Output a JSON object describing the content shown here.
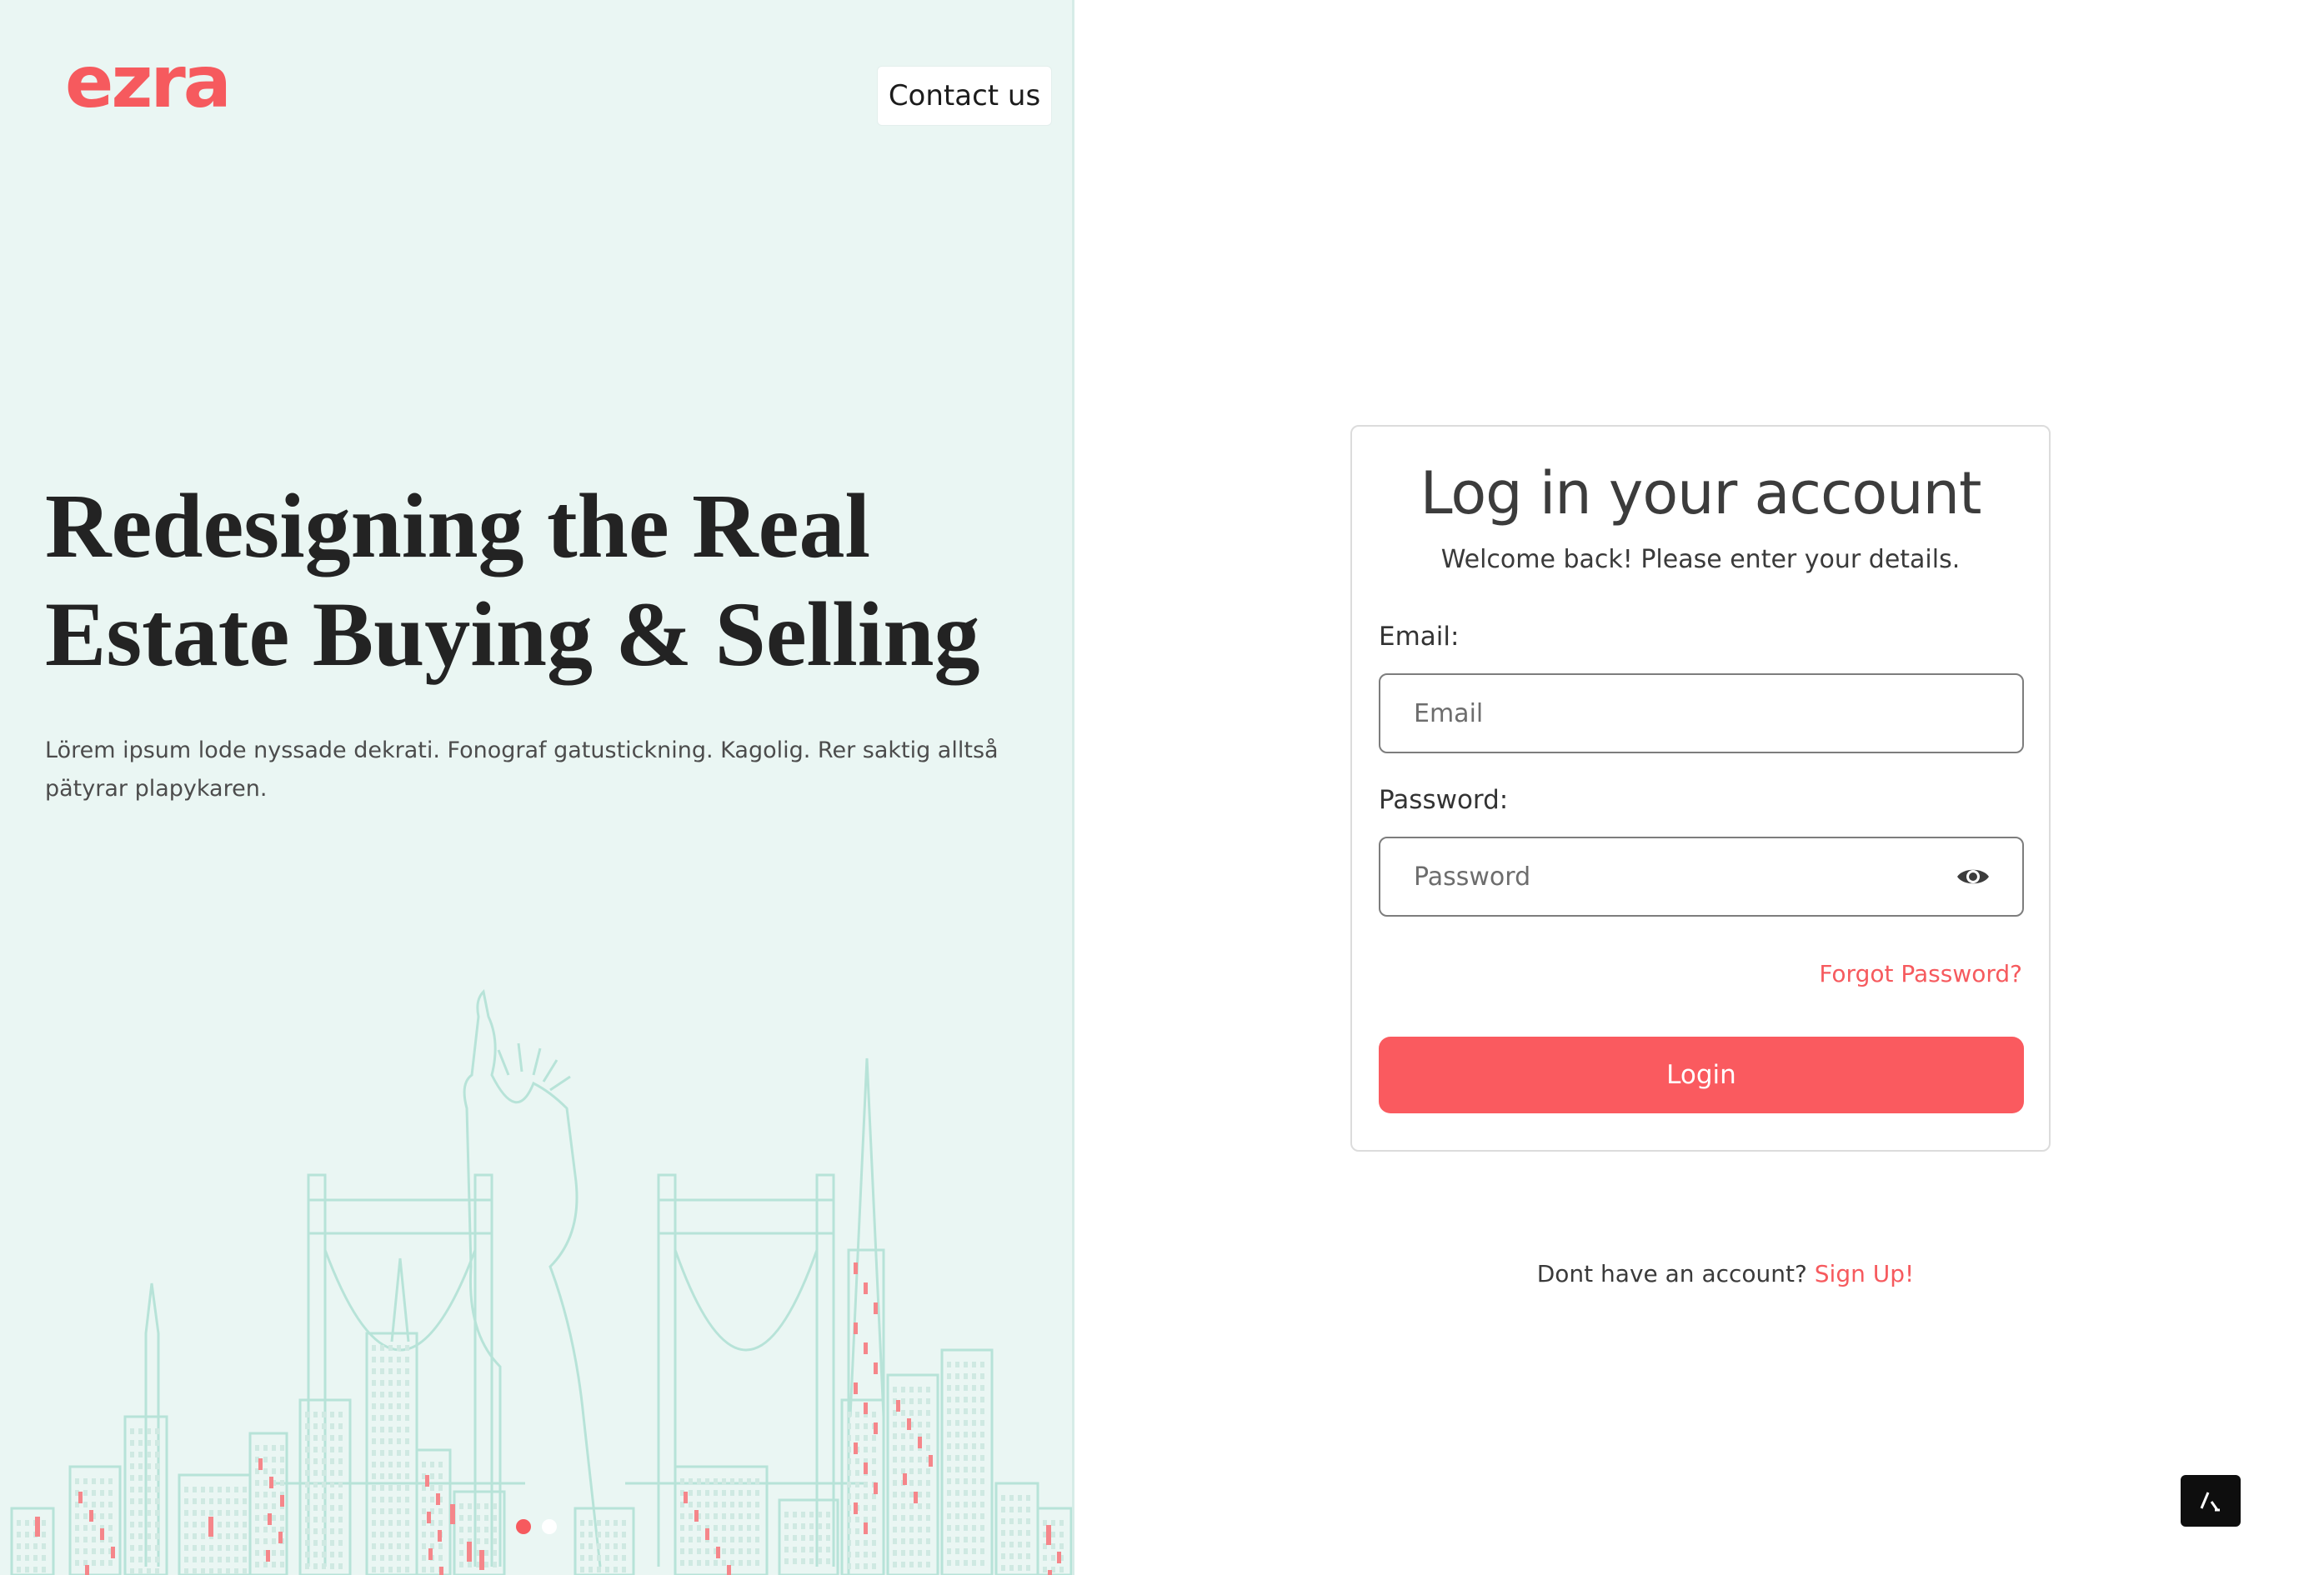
{
  "brand": {
    "logo_text": "ezra",
    "accent_color": "#f65a5e"
  },
  "hero": {
    "contact_label": "Contact us",
    "headline_line1": "Redesigning the Real",
    "headline_line2": "Estate Buying & Selling",
    "description": "Lörem ipsum lode nyssade dekrati. Fonograf gatustickning. Kagolig. Rer saktig alltså pätyrar plapykaren.",
    "illustration": "new-york-skyline-with-statue-of-liberty-and-bridges",
    "carousel": {
      "slides": 2,
      "active_index": 0
    }
  },
  "login": {
    "title": "Log in your account",
    "subtitle": "Welcome back! Please enter your details.",
    "email_label": "Email:",
    "email_placeholder": "Email",
    "email_value": "",
    "password_label": "Password:",
    "password_placeholder": "Password",
    "password_value": "",
    "password_toggle_icon": "eye-icon",
    "forgot_label": "Forgot Password?",
    "submit_label": "Login"
  },
  "signup": {
    "prompt": "Dont have an account?",
    "link_label": "Sign Up!"
  },
  "corner_widget_icon": "slash-logo-icon"
}
